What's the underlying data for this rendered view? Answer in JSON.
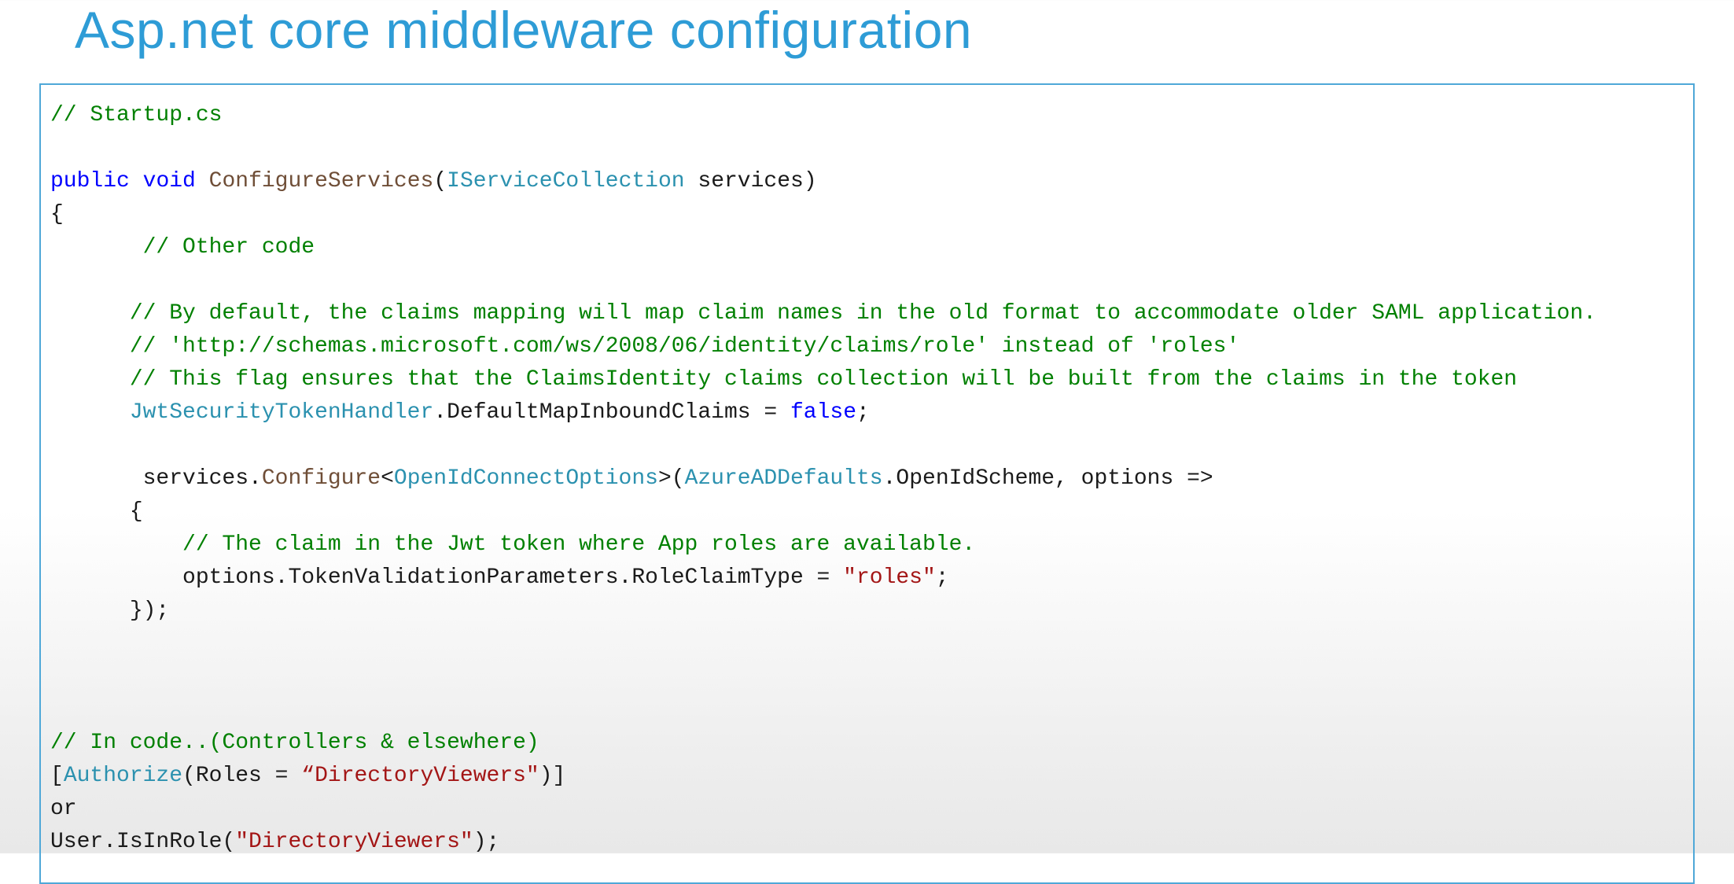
{
  "title": "Asp.net core middleware configuration",
  "code": {
    "c01": "// Startup.cs",
    "c02_kw1": "public",
    "c02_kw2": "void",
    "c02_method": "ConfigureServices",
    "c02_p1": "(",
    "c02_type": "IServiceCollection",
    "c02_p2": " services)",
    "c03": "{",
    "c04": "       // Other code",
    "c05": "      // By default, the claims mapping will map claim names in the old format to accommodate older SAML application.",
    "c06": "      // 'http://schemas.microsoft.com/ws/2008/06/identity/claims/role' instead of 'roles'",
    "c07": "      // This flag ensures that the ClaimsIdentity claims collection will be built from the claims in the token",
    "c08_a": "      ",
    "c08_type": "JwtSecurityTokenHandler",
    "c08_b": ".DefaultMapInboundClaims = ",
    "c08_kw": "false",
    "c08_c": ";",
    "c09_a": "       services.",
    "c09_method": "Configure",
    "c09_b": "<",
    "c09_type1": "OpenIdConnectOptions",
    "c09_c": ">(",
    "c09_type2": "AzureADDefaults",
    "c09_d": ".OpenIdScheme, options =>",
    "c10": "      {",
    "c11": "          // The claim in the Jwt token where App roles are available.",
    "c12_a": "          options.TokenValidationParameters.RoleClaimType = ",
    "c12_str": "\"roles\"",
    "c12_b": ";",
    "c13": "      });",
    "c14": "// In code..(Controllers & elsewhere)",
    "c15_a": "[",
    "c15_attr": "Authorize",
    "c15_b": "(Roles = ",
    "c15_str": "“DirectoryViewers\"",
    "c15_c": ")]",
    "c16": "or",
    "c17_a": "User.IsInRole(",
    "c17_str": "\"DirectoryViewers\"",
    "c17_b": ");"
  }
}
